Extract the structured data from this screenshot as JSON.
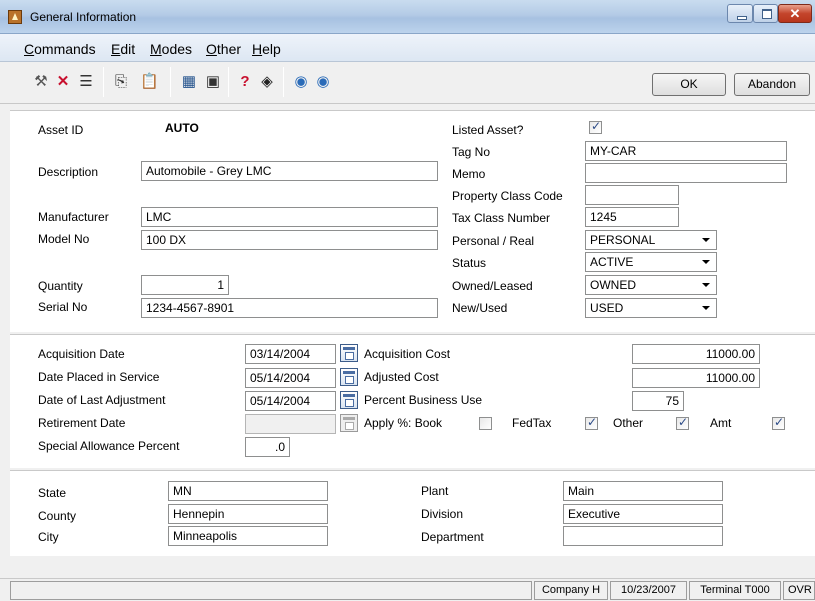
{
  "window": {
    "title": "General Information"
  },
  "menu": {
    "commands": {
      "hotkey": "C",
      "rest": "ommands"
    },
    "edit": {
      "hotkey": "E",
      "rest": "dit"
    },
    "modes": {
      "hotkey": "M",
      "rest": "odes"
    },
    "other": {
      "hotkey": "O",
      "rest": "ther"
    },
    "help": {
      "hotkey": "H",
      "rest": "elp"
    }
  },
  "toolbar": {
    "icons": [
      "tools-icon",
      "delete-icon",
      "list-icon",
      "copy-icon",
      "paste-icon",
      "calculator-icon",
      "note-icon",
      "help-icon",
      "book-icon",
      "previous-icon",
      "next-icon"
    ],
    "ok_label": "OK",
    "abandon_label": "Abandon"
  },
  "asset": {
    "asset_id_label": "Asset ID",
    "asset_id_value": "AUTO",
    "description_label": "Description",
    "description_value": "Automobile - Grey LMC",
    "manufacturer_label": "Manufacturer",
    "manufacturer_value": "LMC",
    "model_label": "Model No",
    "model_value": "100 DX",
    "quantity_label": "Quantity",
    "quantity_value": "1",
    "serial_label": "Serial No",
    "serial_value": "1234-4567-8901",
    "listed_label": "Listed Asset?",
    "listed_checked": true,
    "tag_label": "Tag No",
    "tag_value": "MY-CAR",
    "memo_label": "Memo",
    "memo_value": "",
    "property_class_label": "Property Class Code",
    "property_class_value": "",
    "tax_class_label": "Tax Class Number",
    "tax_class_value": "1245",
    "personal_real_label": "Personal / Real",
    "personal_real_value": "PERSONAL",
    "status_label": "Status",
    "status_value": "ACTIVE",
    "owned_label": "Owned/Leased",
    "owned_value": "OWNED",
    "new_used_label": "New/Used",
    "new_used_value": "USED"
  },
  "dates": {
    "acq_date_label": "Acquisition Date",
    "acq_date_value": "03/14/2004",
    "placed_label": "Date Placed in Service",
    "placed_value": "05/14/2004",
    "last_adj_label": "Date of Last Adjustment",
    "last_adj_value": "05/14/2004",
    "retirement_label": "Retirement Date",
    "retirement_value": "",
    "special_label": "Special Allowance Percent",
    "special_value": ".0",
    "acq_cost_label": "Acquisition Cost",
    "acq_cost_value": "11000.00",
    "adj_cost_label": "Adjusted Cost",
    "adj_cost_value": "11000.00",
    "business_use_label": "Percent Business Use",
    "business_use_value": "75",
    "apply_label": "Apply %: Book",
    "fedtax_label": "FedTax",
    "other_label": "Other",
    "amt_label": "Amt",
    "book_checked": false,
    "fedtax_checked": true,
    "other_checked": true,
    "amt_checked": true
  },
  "location": {
    "state_label": "State",
    "state_value": "MN",
    "county_label": "County",
    "county_value": "Hennepin",
    "city_label": "City",
    "city_value": "Minneapolis",
    "plant_label": "Plant",
    "plant_value": "Main",
    "division_label": "Division",
    "division_value": "Executive",
    "department_label": "Department",
    "department_value": ""
  },
  "status_bar": {
    "company": "Company H",
    "date": "10/23/2007",
    "terminal": "Terminal T000",
    "mode": "OVR"
  }
}
